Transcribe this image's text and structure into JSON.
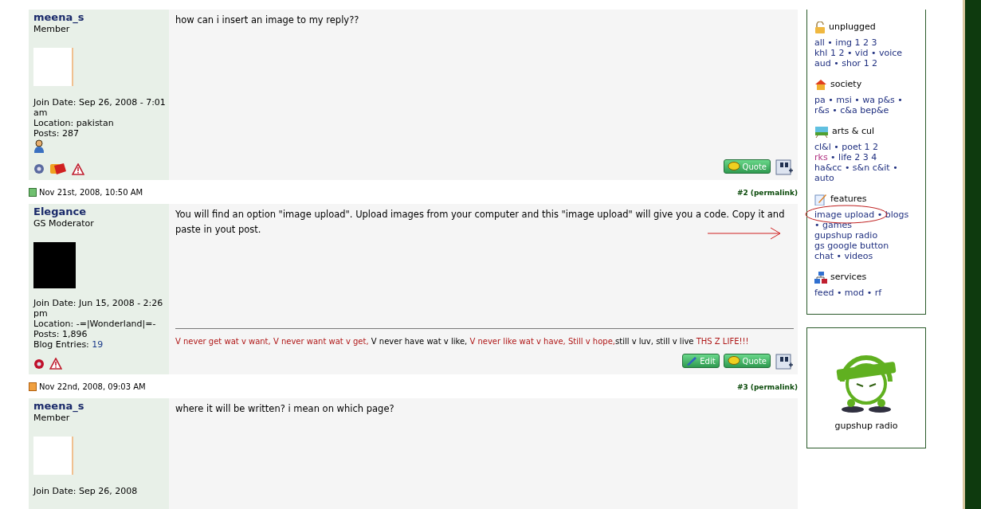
{
  "posts": [
    {
      "author": "meena_s",
      "role": "Member",
      "join_date": "Join Date: Sep 26, 2008 - 7:01 am",
      "location": "Location: pakistan",
      "posts": "Posts: 287",
      "rank_icon": true,
      "icons": [
        {
          "kind": "status",
          "color": "#5a6aa0"
        },
        {
          "kind": "tag"
        },
        {
          "kind": "report"
        }
      ],
      "message": "how can i insert an image to my reply??",
      "buttons": [
        {
          "kind": "quote",
          "label": "Quote"
        }
      ]
    },
    {
      "header": {
        "date": "Nov 21st, 2008, 10:50 AM",
        "unread": false,
        "number": "#2",
        "permalink": "(permalink)"
      },
      "author": "Elegance",
      "role": "GS Moderator",
      "join_date": "Join Date: Jun 15, 2008 - 2:26 pm",
      "location": "Location: -=|Wonderland|=-",
      "posts": "Posts: 1,896",
      "blog_entries": {
        "label": "Blog Entries:",
        "value": "19"
      },
      "icons": [
        {
          "kind": "status",
          "color": "#c0102a"
        },
        {
          "kind": "report"
        }
      ],
      "message": "You will find an option \"image upload\". Upload images from your computer and this \"image upload\" will give you a code. Copy it and paste in yout post.",
      "signature": [
        {
          "text": "V never get wat v want, V never want wat v get, ",
          "highlighted": true
        },
        {
          "text": "V never have wat v like, ",
          "highlighted": false
        },
        {
          "text": "V never like wat v have, Still v hope,",
          "highlighted": true
        },
        {
          "text": "still v luv, still v live ",
          "highlighted": false
        },
        {
          "text": "THS Z LIFE!!!",
          "highlighted": true
        }
      ],
      "buttons": [
        {
          "kind": "edit",
          "label": "Edit"
        },
        {
          "kind": "quote",
          "label": "Quote"
        }
      ],
      "annotated": true
    },
    {
      "header": {
        "date": "Nov 22nd, 2008, 09:03 AM",
        "unread": true,
        "number": "#3",
        "permalink": "(permalink)"
      },
      "author": "meena_s",
      "role": "Member",
      "join_date": "Join Date: Sep 26, 2008",
      "message": "where it will be written? i mean on which page?"
    }
  ],
  "sidebar": {
    "sections": [
      {
        "title": "unplugged",
        "lines": [
          [
            {
              "text": "all • img 1 2 3",
              "visited": false
            }
          ],
          [
            {
              "text": "khl 1 2 • vid • voice",
              "visited": false
            }
          ],
          [
            {
              "text": "aud • shor 1 2",
              "visited": false
            }
          ]
        ]
      },
      {
        "title": "society",
        "lines": [
          [
            {
              "text": "pa • msi • wa p&s •",
              "visited": false
            }
          ],
          [
            {
              "text": "r&s • c&a bep&e",
              "visited": false
            }
          ]
        ]
      },
      {
        "title": "arts & cul",
        "lines": [
          [
            {
              "text": "cl&l • poet 1 2",
              "visited": false
            }
          ],
          [
            {
              "text": "rks",
              "visited": true
            },
            {
              "text": " • life 2 3 4",
              "visited": false
            }
          ],
          [
            {
              "text": "ha&cc • s&n c&it •",
              "visited": false
            }
          ],
          [
            {
              "text": "auto",
              "visited": false
            }
          ]
        ]
      },
      {
        "title": "features",
        "circled": true,
        "lines": [
          [
            {
              "text": "image upload • blogs",
              "visited": false
            }
          ],
          [
            {
              "text": "• games",
              "visited": false
            }
          ],
          [
            {
              "text": "gupshup radio",
              "visited": false
            }
          ],
          [
            {
              "text": "gs google button",
              "visited": false
            }
          ],
          [
            {
              "text": "chat • videos",
              "visited": false
            }
          ]
        ]
      },
      {
        "title": "services",
        "lines": [
          [
            {
              "text": "feed • mod • rf",
              "visited": false
            }
          ]
        ]
      }
    ]
  },
  "radio_box": {
    "caption": "gupshup radio"
  }
}
